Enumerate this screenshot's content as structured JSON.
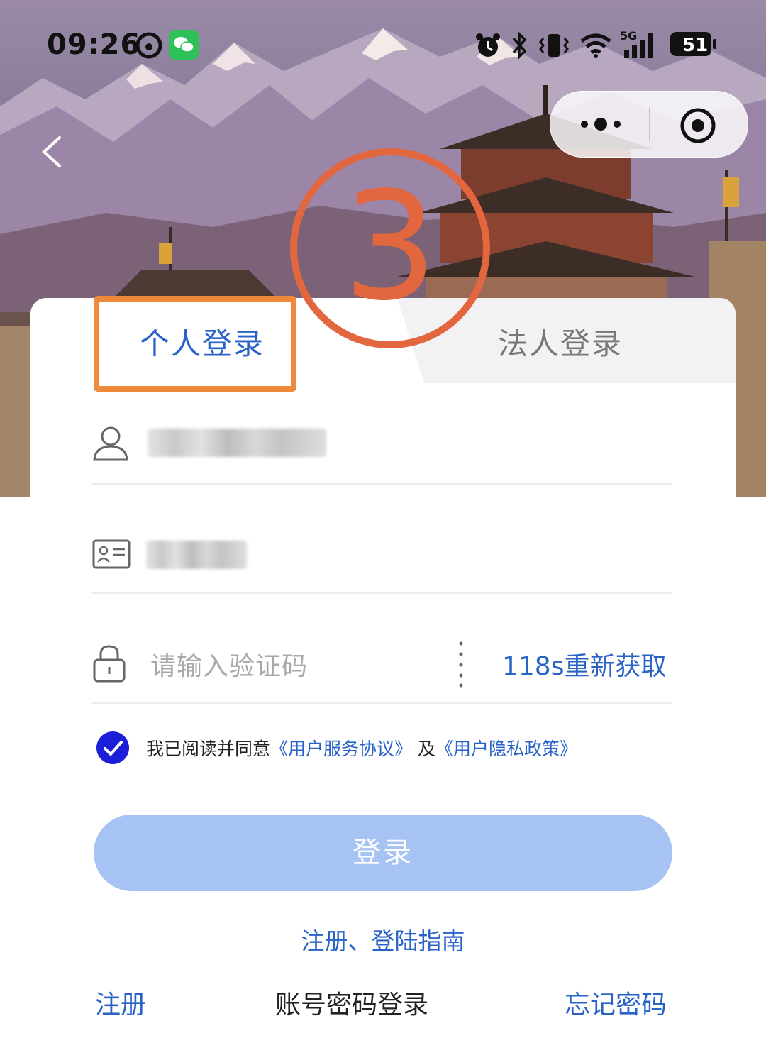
{
  "status_bar": {
    "time": "09:26",
    "signal_label": "5G",
    "battery": "51",
    "icons": [
      "assistant-icon",
      "wechat-icon",
      "alarm-icon",
      "bluetooth-icon",
      "vibrate-icon",
      "wifi-icon",
      "signal-icon",
      "battery-icon"
    ]
  },
  "nav": {
    "back_icon": "chevron-left-icon",
    "capsule_icons": [
      "more-dots-icon",
      "close-target-icon"
    ]
  },
  "annotation": {
    "step": "3",
    "color": "#e2663e",
    "box_color": "#ef8a3a"
  },
  "tabs": [
    {
      "label": "个人登录",
      "active": true
    },
    {
      "label": "法人登录",
      "active": false
    }
  ],
  "form": {
    "phone_icon": "user-icon",
    "id_icon": "id-card-icon",
    "lock_icon": "lock-icon",
    "code_placeholder": "请输入验证码",
    "resend_label": "118s重新获取"
  },
  "agreement": {
    "checked": true,
    "prefix": "我已阅读并同意",
    "terms": "《用户服务协议》",
    "and": "及",
    "privacy": "《用户隐私政策》"
  },
  "login_button": "登录",
  "guide_link": "注册、登陆指南",
  "footer": {
    "register": "注册",
    "password_login": "账号密码登录",
    "forgot": "忘记密码"
  },
  "colors": {
    "accent": "#2a63c7",
    "button_disabled": "#a6c3f3",
    "checkbox": "#1d1fd8"
  }
}
